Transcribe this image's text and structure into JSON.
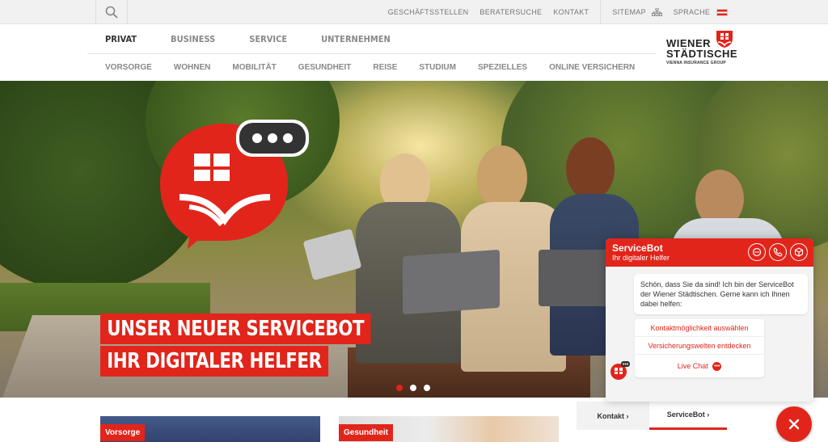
{
  "utility_bar": {
    "links": [
      "GESCHÄFTSSTELLEN",
      "BERATERSUCHE",
      "KONTAKT"
    ],
    "sitemap_label": "SITEMAP",
    "language_label": "SPRACHE"
  },
  "main_nav": {
    "items": [
      "PRIVAT",
      "BUSINESS",
      "SERVICE",
      "UNTERNEHMEN"
    ],
    "active": "PRIVAT"
  },
  "sub_nav": {
    "items": [
      "VORSORGE",
      "WOHNEN",
      "MOBILITÄT",
      "GESUNDHEIT",
      "REISE",
      "STUDIUM",
      "SPEZIELLES",
      "ONLINE VERSICHERN"
    ]
  },
  "logo": {
    "line1": "WIENER",
    "line2": "STÄDTISCHE",
    "line3": "VIENNA INSURANCE GROUP"
  },
  "hero": {
    "headline1": "UNSER NEUER SERVICEBOT",
    "headline2": "IHR DIGITALER HELFER",
    "slide_count": 3,
    "active_slide": 1
  },
  "tiles": [
    {
      "label": "Vorsorge"
    },
    {
      "label": "Gesundheit"
    }
  ],
  "chat": {
    "title": "ServiceBot",
    "subtitle": "Ihr digitaler Helfer",
    "message": "Schön, dass Sie da sind! Ich bin der ServiceBot der Wiener Städtischen. Gerne kann ich Ihnen dabei helfen:",
    "options": [
      "Kontaktmöglichkeit auswählen",
      "Versicherungswelten entdecken",
      "Live Chat"
    ]
  },
  "contact_tabs": {
    "kontakt": "Kontakt ›",
    "servicebot": "ServiceBot ›"
  },
  "colors": {
    "brand_red": "#e1251b",
    "text_gray": "#888888"
  }
}
